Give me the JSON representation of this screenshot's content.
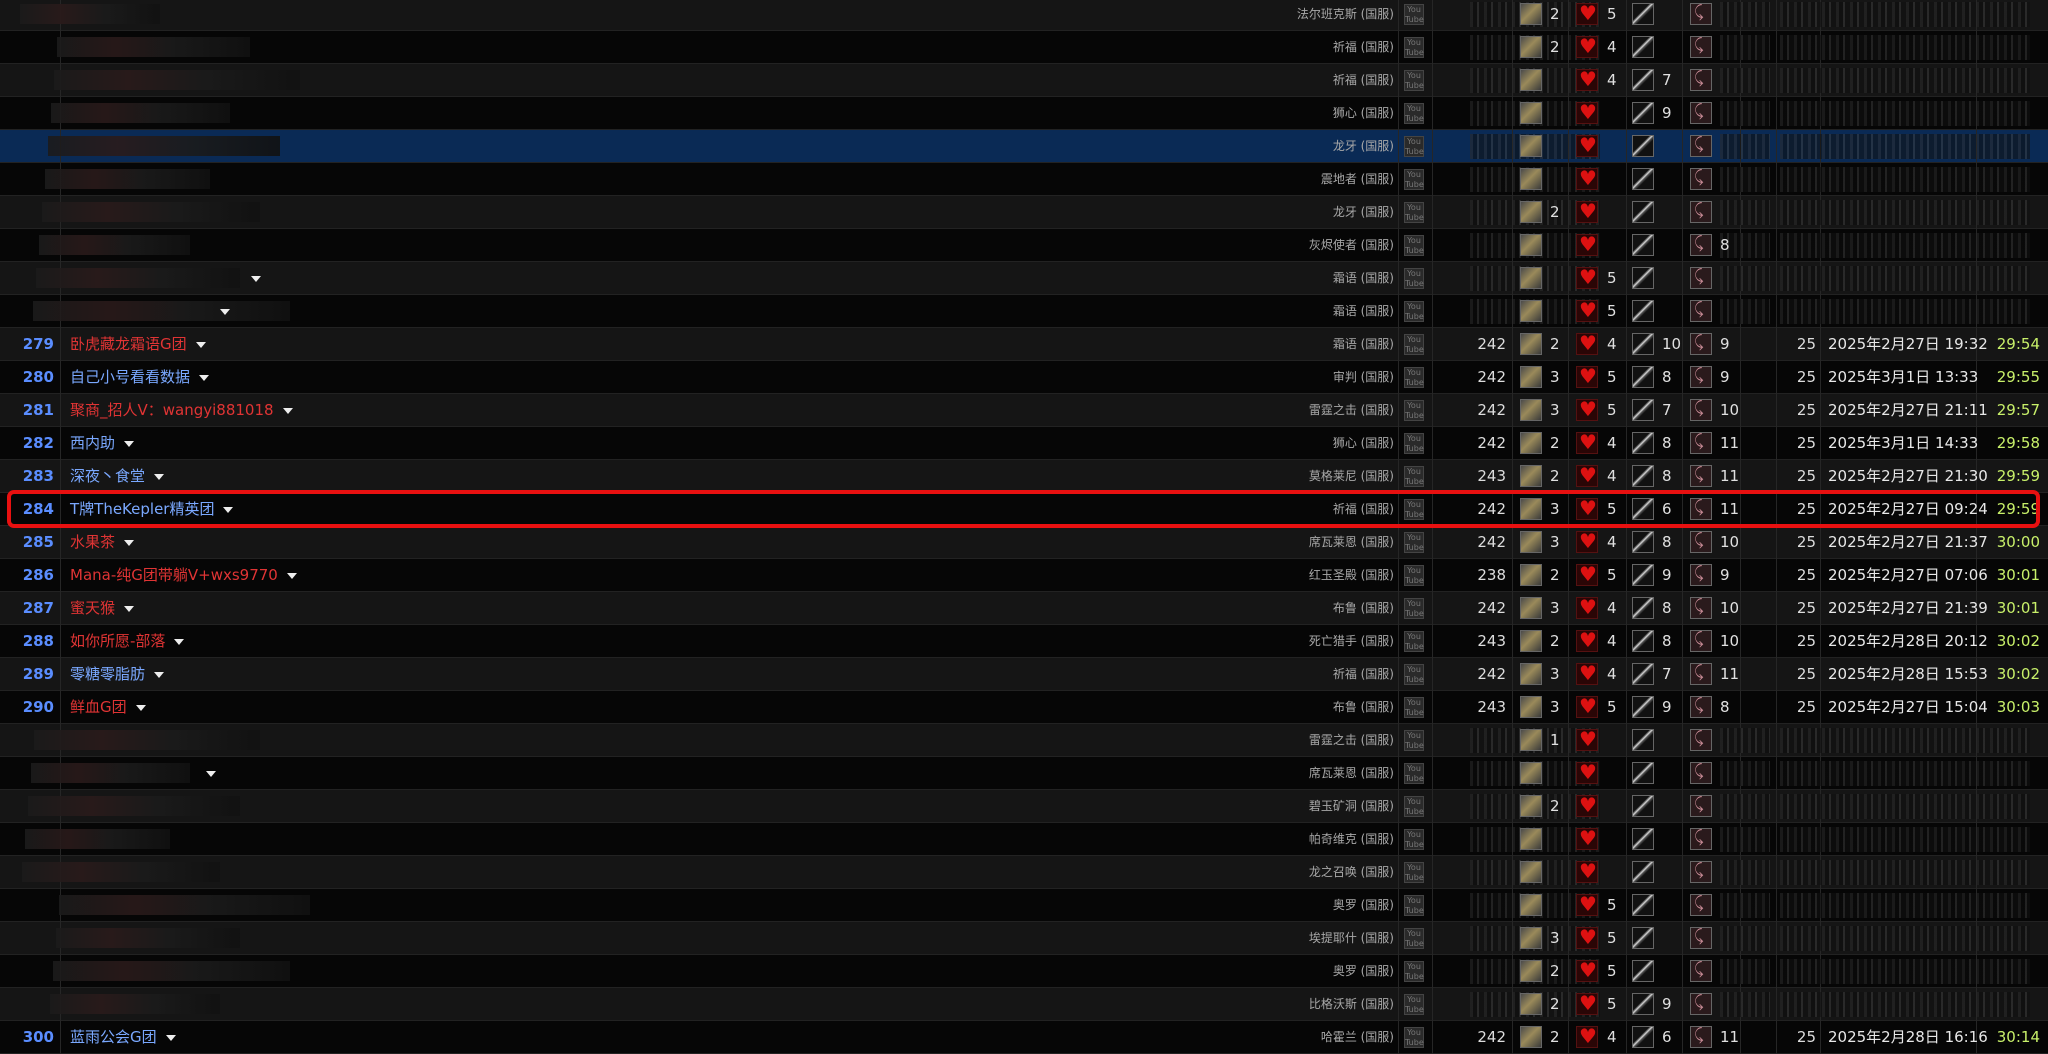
{
  "table": {
    "rows": [
      {
        "rank": "",
        "name": "",
        "name_color": "white",
        "caret": false,
        "realm": "法尔班克斯 (国服)",
        "ilvl": "",
        "tanks": "2",
        "healers": "5",
        "dps1": "",
        "dps2": "",
        "size": "",
        "date": "",
        "time": "",
        "garbled": true
      },
      {
        "rank": "",
        "name": "",
        "name_color": "white",
        "caret": false,
        "realm": "祈福 (国服)",
        "ilvl": "",
        "tanks": "2",
        "healers": "4",
        "dps1": "",
        "dps2": "",
        "size": "",
        "date": "",
        "time": "",
        "garbled": true
      },
      {
        "rank": "",
        "name": "",
        "name_color": "white",
        "caret": false,
        "realm": "祈福 (国服)",
        "ilvl": "",
        "tanks": "",
        "healers": "4",
        "dps1": "7",
        "dps2": "",
        "size": "",
        "date": "",
        "time": "",
        "garbled": true
      },
      {
        "rank": "",
        "name": "",
        "name_color": "white",
        "caret": false,
        "realm": "狮心 (国服)",
        "ilvl": "",
        "tanks": "",
        "healers": "",
        "dps1": "9",
        "dps2": "",
        "size": "",
        "date": "",
        "time": "",
        "garbled": true
      },
      {
        "rank": "",
        "name": "",
        "name_color": "white",
        "caret": false,
        "realm": "龙牙 (国服)",
        "ilvl": "",
        "tanks": "",
        "healers": "",
        "dps1": "",
        "dps2": "",
        "size": "",
        "date": "",
        "time": "",
        "garbled": true,
        "selected": true
      },
      {
        "rank": "",
        "name": "",
        "name_color": "white",
        "caret": false,
        "realm": "震地者 (国服)",
        "ilvl": "",
        "tanks": "",
        "healers": "",
        "dps1": "",
        "dps2": "",
        "size": "",
        "date": "",
        "time": "",
        "garbled": true
      },
      {
        "rank": "",
        "name": "",
        "name_color": "white",
        "caret": false,
        "realm": "龙牙 (国服)",
        "ilvl": "",
        "tanks": "2",
        "healers": "",
        "dps1": "",
        "dps2": "",
        "size": "",
        "date": "",
        "time": "",
        "garbled": true
      },
      {
        "rank": "",
        "name": "",
        "name_color": "white",
        "caret": false,
        "realm": "灰烬使者 (国服)",
        "ilvl": "",
        "tanks": "",
        "healers": "",
        "dps1": "",
        "dps2": "8",
        "size": "",
        "date": "",
        "time": "",
        "garbled": true
      },
      {
        "rank": "",
        "name": "",
        "name_color": "white",
        "caret": true,
        "realm": "霜语 (国服)",
        "ilvl": "",
        "tanks": "",
        "healers": "5",
        "dps1": "",
        "dps2": "",
        "size": "",
        "date": "",
        "time": "",
        "garbled": true
      },
      {
        "rank": "",
        "name": "",
        "name_color": "white",
        "caret": true,
        "realm": "霜语 (国服)",
        "ilvl": "",
        "tanks": "",
        "healers": "5",
        "dps1": "",
        "dps2": "",
        "size": "",
        "date": "",
        "time": "",
        "garbled": true
      },
      {
        "rank": "279",
        "name": "卧虎藏龙霜语G团",
        "name_color": "red",
        "caret": true,
        "realm": "霜语 (国服)",
        "ilvl": "242",
        "tanks": "2",
        "healers": "4",
        "dps1": "10",
        "dps2": "9",
        "size": "25",
        "date": "2025年2月27日 19:32",
        "time": "29:54"
      },
      {
        "rank": "280",
        "name": "自己小号看看数据",
        "name_color": "blue",
        "caret": true,
        "realm": "审判 (国服)",
        "ilvl": "242",
        "tanks": "3",
        "healers": "5",
        "dps1": "8",
        "dps2": "9",
        "size": "25",
        "date": "2025年3月1日 13:33",
        "time": "29:55"
      },
      {
        "rank": "281",
        "name": "聚商_招人V：wangyi881018",
        "name_color": "red",
        "caret": true,
        "realm": "雷霆之击 (国服)",
        "ilvl": "242",
        "tanks": "3",
        "healers": "5",
        "dps1": "7",
        "dps2": "10",
        "size": "25",
        "date": "2025年2月27日 21:11",
        "time": "29:57"
      },
      {
        "rank": "282",
        "name": "西内助",
        "name_color": "blue",
        "caret": true,
        "realm": "狮心 (国服)",
        "ilvl": "242",
        "tanks": "2",
        "healers": "4",
        "dps1": "8",
        "dps2": "11",
        "size": "25",
        "date": "2025年3月1日 14:33",
        "time": "29:58"
      },
      {
        "rank": "283",
        "name": "深夜丶食堂",
        "name_color": "blue",
        "caret": true,
        "realm": "莫格莱尼 (国服)",
        "ilvl": "243",
        "tanks": "2",
        "healers": "4",
        "dps1": "8",
        "dps2": "11",
        "size": "25",
        "date": "2025年2月27日 21:30",
        "time": "29:59"
      },
      {
        "rank": "284",
        "name": "T牌TheKepler精英团",
        "name_color": "blue",
        "caret": true,
        "realm": "祈福 (国服)",
        "ilvl": "242",
        "tanks": "3",
        "healers": "5",
        "dps1": "6",
        "dps2": "11",
        "size": "25",
        "date": "2025年2月27日 09:24",
        "time": "29:59",
        "highlight": true
      },
      {
        "rank": "285",
        "name": "水果茶",
        "name_color": "red",
        "caret": true,
        "realm": "席瓦莱恩 (国服)",
        "ilvl": "242",
        "tanks": "3",
        "healers": "4",
        "dps1": "8",
        "dps2": "10",
        "size": "25",
        "date": "2025年2月27日 21:37",
        "time": "30:00"
      },
      {
        "rank": "286",
        "name": "Mana-纯G团带躺V+wxs9770",
        "name_color": "red",
        "caret": true,
        "realm": "红玉圣殿 (国服)",
        "ilvl": "238",
        "tanks": "2",
        "healers": "5",
        "dps1": "9",
        "dps2": "9",
        "size": "25",
        "date": "2025年2月27日 07:06",
        "time": "30:01"
      },
      {
        "rank": "287",
        "name": "蜜天猴",
        "name_color": "red",
        "caret": true,
        "realm": "布鲁 (国服)",
        "ilvl": "242",
        "tanks": "3",
        "healers": "4",
        "dps1": "8",
        "dps2": "10",
        "size": "25",
        "date": "2025年2月27日 21:39",
        "time": "30:01"
      },
      {
        "rank": "288",
        "name": "如你所愿-部落",
        "name_color": "red",
        "caret": true,
        "realm": "死亡猎手 (国服)",
        "ilvl": "243",
        "tanks": "2",
        "healers": "4",
        "dps1": "8",
        "dps2": "10",
        "size": "25",
        "date": "2025年2月28日 20:12",
        "time": "30:02"
      },
      {
        "rank": "289",
        "name": "零糖零脂肪",
        "name_color": "blue",
        "caret": true,
        "realm": "祈福 (国服)",
        "ilvl": "242",
        "tanks": "3",
        "healers": "4",
        "dps1": "7",
        "dps2": "11",
        "size": "25",
        "date": "2025年2月28日 15:53",
        "time": "30:02"
      },
      {
        "rank": "290",
        "name": "鲜血G团",
        "name_color": "red",
        "caret": true,
        "realm": "布鲁 (国服)",
        "ilvl": "243",
        "tanks": "3",
        "healers": "5",
        "dps1": "9",
        "dps2": "8",
        "size": "25",
        "date": "2025年2月27日 15:04",
        "time": "30:03"
      },
      {
        "rank": "",
        "name": "",
        "name_color": "white",
        "caret": false,
        "realm": "雷霆之击 (国服)",
        "ilvl": "",
        "tanks": "1",
        "healers": "",
        "dps1": "",
        "dps2": "",
        "size": "",
        "date": "",
        "time": "",
        "garbled": true
      },
      {
        "rank": "",
        "name": "",
        "name_color": "white",
        "caret": true,
        "realm": "席瓦莱恩 (国服)",
        "ilvl": "",
        "tanks": "",
        "healers": "",
        "dps1": "",
        "dps2": "",
        "size": "",
        "date": "",
        "time": "",
        "garbled": true
      },
      {
        "rank": "",
        "name": "",
        "name_color": "white",
        "caret": false,
        "realm": "碧玉矿洞 (国服)",
        "ilvl": "",
        "tanks": "2",
        "healers": "",
        "dps1": "",
        "dps2": "",
        "size": "",
        "date": "",
        "time": "",
        "garbled": true
      },
      {
        "rank": "",
        "name": "",
        "name_color": "white",
        "caret": false,
        "realm": "帕奇维克 (国服)",
        "ilvl": "",
        "tanks": "",
        "healers": "",
        "dps1": "",
        "dps2": "",
        "size": "",
        "date": "",
        "time": "",
        "garbled": true
      },
      {
        "rank": "",
        "name": "",
        "name_color": "white",
        "caret": false,
        "realm": "龙之召唤 (国服)",
        "ilvl": "",
        "tanks": "",
        "healers": "",
        "dps1": "",
        "dps2": "",
        "size": "",
        "date": "",
        "time": "",
        "garbled": true
      },
      {
        "rank": "",
        "name": "",
        "name_color": "white",
        "caret": false,
        "realm": "奥罗 (国服)",
        "ilvl": "",
        "tanks": "",
        "healers": "5",
        "dps1": "",
        "dps2": "",
        "size": "",
        "date": "",
        "time": "",
        "garbled": true
      },
      {
        "rank": "",
        "name": "",
        "name_color": "white",
        "caret": false,
        "realm": "埃提耶什 (国服)",
        "ilvl": "",
        "tanks": "3",
        "healers": "5",
        "dps1": "",
        "dps2": "",
        "size": "",
        "date": "",
        "time": "",
        "garbled": true
      },
      {
        "rank": "",
        "name": "",
        "name_color": "white",
        "caret": false,
        "realm": "奥罗 (国服)",
        "ilvl": "",
        "tanks": "2",
        "healers": "5",
        "dps1": "",
        "dps2": "",
        "size": "",
        "date": "",
        "time": "",
        "garbled": true
      },
      {
        "rank": "",
        "name": "",
        "name_color": "white",
        "caret": false,
        "realm": "比格沃斯 (国服)",
        "ilvl": "",
        "tanks": "2",
        "healers": "5",
        "dps1": "9",
        "dps2": "",
        "size": "",
        "date": "",
        "time": "",
        "garbled": true
      },
      {
        "rank": "300",
        "name": "蓝雨公会G团",
        "name_color": "blue",
        "caret": true,
        "realm": "哈霍兰 (国服)",
        "ilvl": "242",
        "tanks": "2",
        "healers": "4",
        "dps1": "6",
        "dps2": "11",
        "size": "25",
        "date": "2025年2月28日 16:16",
        "time": "30:14"
      }
    ]
  },
  "icons": {
    "video": "video-icon",
    "tank": "tank-gear-icon",
    "healer": "healer-heart-icon",
    "melee": "melee-sword-icon",
    "ranged": "ranged-claw-icon",
    "menu": "dropdown-caret-icon"
  },
  "colors": {
    "background": "#050505",
    "rank": "#5a8dff",
    "guild_red": "#e03434",
    "guild_blue": "#7aa8ff",
    "time": "#c8f06a",
    "highlight_border": "#e81010",
    "selected_row": "#0a2a55"
  }
}
